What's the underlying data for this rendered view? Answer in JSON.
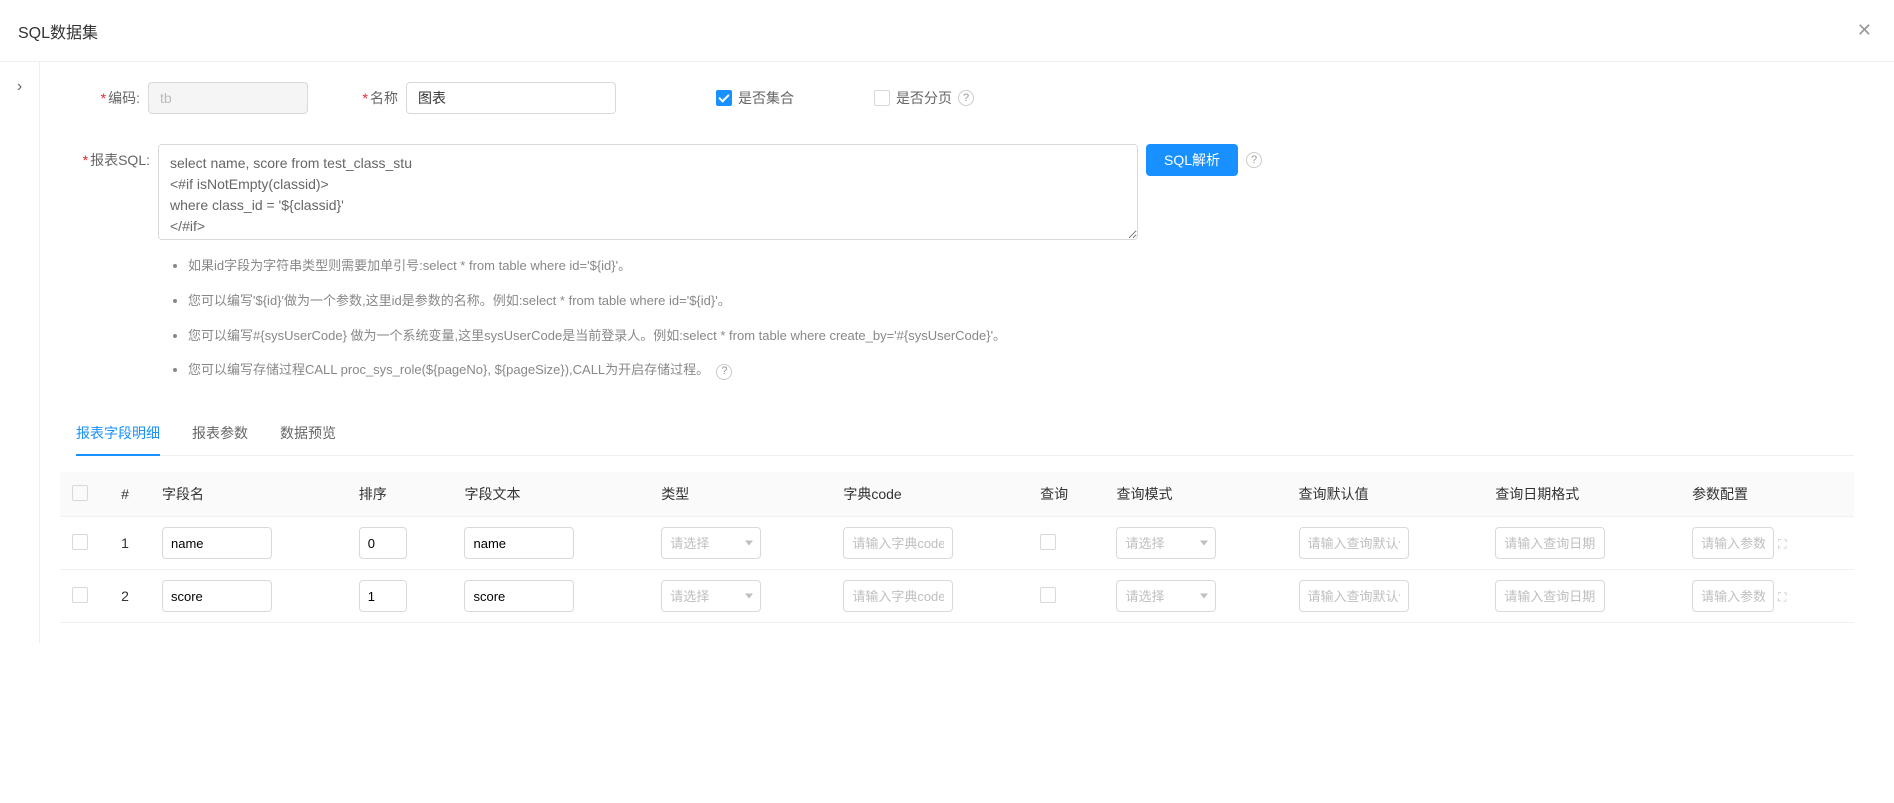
{
  "header": {
    "title": "SQL数据集"
  },
  "form": {
    "code": {
      "label": "编码:",
      "value": "tb"
    },
    "name": {
      "label": "名称",
      "value": "图表"
    },
    "is_collection": {
      "label": "是否集合",
      "checked": true
    },
    "is_paging": {
      "label": "是否分页",
      "checked": false
    },
    "sql": {
      "label": "报表SQL:",
      "value": "select name, score from test_class_stu\n<#if isNotEmpty(classid)>\nwhere class_id = '${classid}'\n</#if>"
    },
    "parse_btn": "SQL解析"
  },
  "hints": {
    "h1": "如果id字段为字符串类型则需要加单引号:select * from table where id='${id}'。",
    "h2": "您可以编写'${id}'做为一个参数,这里id是参数的名称。例如:select * from table where id='${id}'。",
    "h3": "您可以编写#{sysUserCode} 做为一个系统变量,这里sysUserCode是当前登录人。例如:select * from table where create_by='#{sysUserCode}'。",
    "h4": "您可以编写存储过程CALL proc_sys_role(${pageNo}, ${pageSize}),CALL为开启存储过程。"
  },
  "tabs": {
    "t1": "报表字段明细",
    "t2": "报表参数",
    "t3": "数据预览"
  },
  "table": {
    "headers": {
      "num": "#",
      "field_name": "字段名",
      "sort": "排序",
      "field_text": "字段文本",
      "type": "类型",
      "dict_code": "字典code",
      "query": "查询",
      "query_mode": "查询模式",
      "query_default": "查询默认值",
      "query_date_fmt": "查询日期格式",
      "param_config": "参数配置"
    },
    "placeholders": {
      "type": "请选择",
      "dict": "请输入字典code",
      "query_mode": "请选择",
      "query_default": "请输入查询默认值",
      "query_date_fmt": "请输入查询日期格式",
      "param_config": "请输入参数"
    },
    "rows": [
      {
        "num": "1",
        "field_name": "name",
        "sort": "0",
        "field_text": "name"
      },
      {
        "num": "2",
        "field_name": "score",
        "sort": "1",
        "field_text": "score"
      }
    ]
  }
}
